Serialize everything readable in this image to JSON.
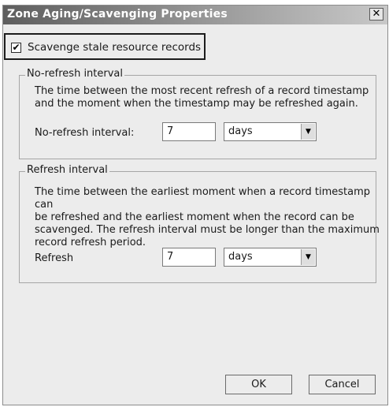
{
  "dialog": {
    "title": "Zone Aging/Scavenging Properties",
    "close_glyph": "✕"
  },
  "scavenge": {
    "label": "Scavenge stale resource records",
    "checked": true,
    "check_glyph": "✔"
  },
  "no_refresh": {
    "group_title": "No-refresh interval",
    "description_lines": [
      "The time between the most recent refresh of a record timestamp",
      "and the moment when the timestamp may be refreshed again."
    ],
    "field_label": "No-refresh interval:",
    "value": "7",
    "unit": "days"
  },
  "refresh": {
    "group_title": "Refresh interval",
    "description_lines": [
      "The time between the earliest moment when a record timestamp can",
      "be refreshed and the earliest moment when the record can be",
      "scavenged. The refresh interval must be longer than the maximum",
      "record refresh period."
    ],
    "field_label": "Refresh",
    "value": "7",
    "unit": "days"
  },
  "dropdown_glyph": "▼",
  "buttons": {
    "ok": "OK",
    "cancel": "Cancel"
  }
}
